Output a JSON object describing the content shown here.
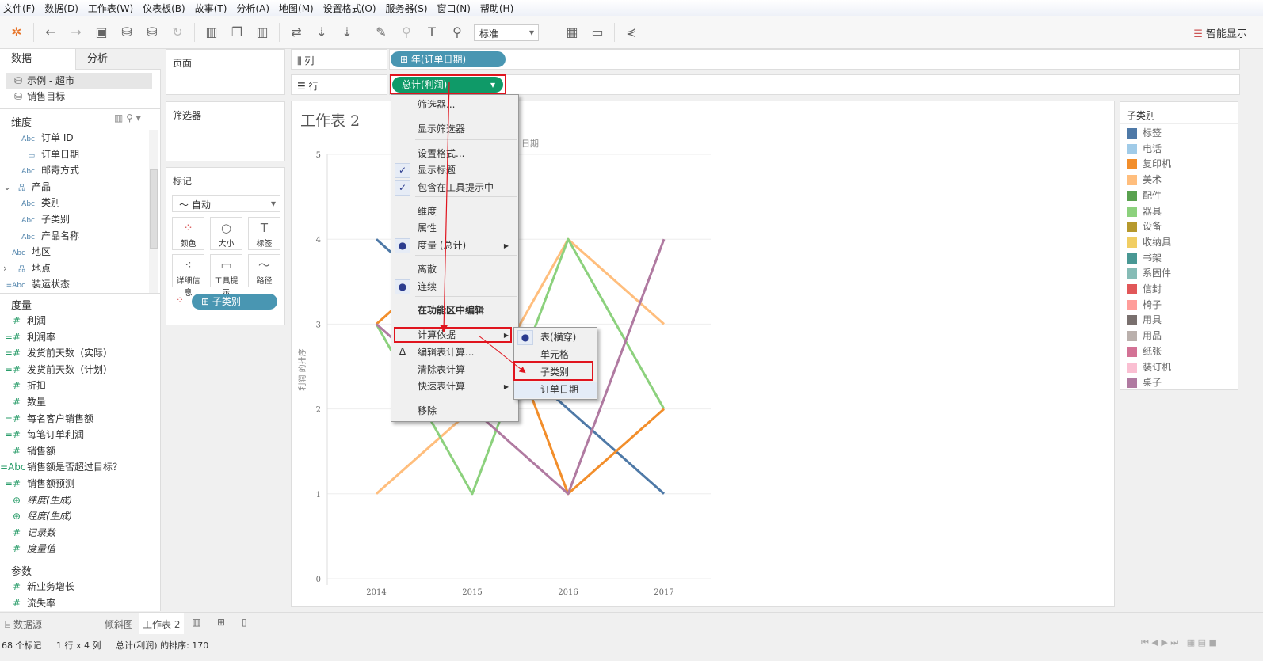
{
  "menubar": [
    "文件(F)",
    "数据(D)",
    "工作表(W)",
    "仪表板(B)",
    "故事(T)",
    "分析(A)",
    "地图(M)",
    "设置格式(O)",
    "服务器(S)",
    "窗口(N)",
    "帮助(H)"
  ],
  "toolbar": {
    "fit_select": "标准",
    "smart_show": "智能显示"
  },
  "left": {
    "tab_data": "数据",
    "tab_analysis": "分析",
    "sources": [
      "示例 - 超市",
      "销售目标"
    ],
    "dimensions_title": "维度",
    "dimensions": [
      {
        "icon": "Abc",
        "label": "订单 ID",
        "indent": 1
      },
      {
        "icon": "date",
        "label": "订单日期",
        "indent": 1
      },
      {
        "icon": "Abc",
        "label": "邮寄方式",
        "indent": 1
      },
      {
        "icon": "hier",
        "label": "产品",
        "indent": 0,
        "expand": "⌄"
      },
      {
        "icon": "Abc",
        "label": "类别",
        "indent": 1
      },
      {
        "icon": "Abc",
        "label": "子类别",
        "indent": 1
      },
      {
        "icon": "Abc",
        "label": "产品名称",
        "indent": 1
      },
      {
        "icon": "Abc",
        "label": "地区",
        "indent": 0
      },
      {
        "icon": "hier",
        "label": "地点",
        "indent": 0,
        "expand": "›"
      },
      {
        "icon": "=Abc",
        "label": "装运状态",
        "indent": 0
      }
    ],
    "measures_title": "度量",
    "measures": [
      {
        "icon": "#",
        "label": "利润"
      },
      {
        "icon": "=#",
        "label": "利润率"
      },
      {
        "icon": "=#",
        "label": "发货前天数（实际）"
      },
      {
        "icon": "=#",
        "label": "发货前天数（计划）"
      },
      {
        "icon": "#",
        "label": "折扣"
      },
      {
        "icon": "#",
        "label": "数量"
      },
      {
        "icon": "=#",
        "label": "每名客户销售额"
      },
      {
        "icon": "=#",
        "label": "每笔订单利润"
      },
      {
        "icon": "#",
        "label": "销售额"
      },
      {
        "icon": "=Abc",
        "label": "销售额是否超过目标？"
      },
      {
        "icon": "=#",
        "label": "销售额预测"
      },
      {
        "icon": "globe",
        "label": "纬度(生成)",
        "italic": true
      },
      {
        "icon": "globe",
        "label": "经度(生成)",
        "italic": true
      },
      {
        "icon": "#",
        "label": "记录数",
        "italic": true
      },
      {
        "icon": "#",
        "label": "度量值",
        "italic": true
      }
    ],
    "params_title": "参数",
    "params": [
      {
        "icon": "#",
        "label": "新业务增长"
      },
      {
        "icon": "#",
        "label": "流失率"
      }
    ]
  },
  "cards": {
    "pages": "页面",
    "filters": "筛选器",
    "marks": "标记",
    "mark_type": "自动",
    "mark_buttons": [
      "颜色",
      "大小",
      "标签",
      "详细信息",
      "工具提示",
      "路径"
    ],
    "color_pill": "子类别"
  },
  "shelves": {
    "columns_label": "列",
    "rows_label": "行",
    "columns_pill": "年(订单日期)",
    "rows_pill": "总计(利润)"
  },
  "sheet": {
    "title": "工作表 2",
    "header_partial": "日期"
  },
  "context_menu": {
    "items": [
      "筛选器...",
      "显示筛选器",
      "设置格式...",
      "显示标题",
      "包含在工具提示中",
      "维度",
      "属性",
      "度量 (总计)",
      "离散",
      "连续",
      "在功能区中编辑",
      "计算依据",
      "编辑表计算...",
      "清除表计算",
      "快速表计算",
      "移除"
    ],
    "submenu": [
      "表(横穿)",
      "单元格",
      "子类别",
      "订单日期"
    ]
  },
  "chart_data": {
    "type": "line",
    "x": [
      "2014",
      "2015",
      "2016",
      "2017"
    ],
    "ylabel": "利润 的排序",
    "ylim": [
      0,
      5
    ],
    "yticks": [
      0,
      1,
      2,
      3,
      4,
      5
    ],
    "grid": true,
    "series": [
      {
        "name": "标签",
        "color": "#4e79a7",
        "values": [
          4,
          3,
          2,
          1
        ]
      },
      {
        "name": "美术",
        "color": "#ffbe7d",
        "values": [
          1,
          2,
          4,
          3
        ]
      },
      {
        "name": "器具",
        "color": "#8cd17d",
        "values": [
          3,
          1,
          4,
          2
        ]
      },
      {
        "name": "复印机",
        "color": "#f28e2b",
        "values": [
          3,
          4,
          1,
          2
        ]
      },
      {
        "name": "桌子",
        "color": "#b07aa1",
        "values": [
          3,
          2,
          1,
          4
        ]
      }
    ]
  },
  "legend": {
    "title": "子类别",
    "items": [
      {
        "label": "标签",
        "color": "#4e79a7"
      },
      {
        "label": "电话",
        "color": "#a0cbe8"
      },
      {
        "label": "复印机",
        "color": "#f28e2b"
      },
      {
        "label": "美术",
        "color": "#ffbe7d"
      },
      {
        "label": "配件",
        "color": "#59a14f"
      },
      {
        "label": "器具",
        "color": "#8cd17d"
      },
      {
        "label": "设备",
        "color": "#b6992d"
      },
      {
        "label": "收纳具",
        "color": "#f1ce63"
      },
      {
        "label": "书架",
        "color": "#499894"
      },
      {
        "label": "系固件",
        "color": "#86bcb6"
      },
      {
        "label": "信封",
        "color": "#e15759"
      },
      {
        "label": "椅子",
        "color": "#ff9d9a"
      },
      {
        "label": "用具",
        "color": "#79706e"
      },
      {
        "label": "用品",
        "color": "#bab0ac"
      },
      {
        "label": "纸张",
        "color": "#d37295"
      },
      {
        "label": "装订机",
        "color": "#fabfd2"
      },
      {
        "label": "桌子",
        "color": "#b07aa1"
      }
    ]
  },
  "bottom": {
    "datasource": "数据源",
    "tabs": [
      "倾斜图",
      "工作表 2"
    ]
  },
  "status": {
    "marks": "68 个标记",
    "dims": "1 行 x 4 列",
    "sort": "总计(利润) 的排序: 170"
  }
}
